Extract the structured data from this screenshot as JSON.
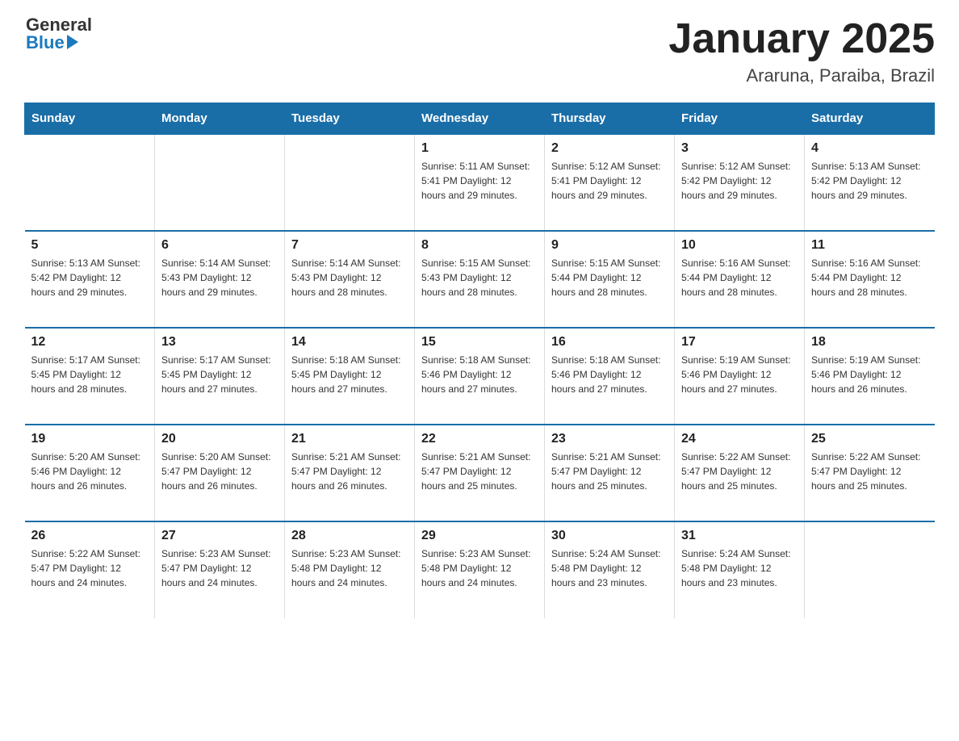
{
  "header": {
    "logo_general": "General",
    "logo_blue": "Blue",
    "title": "January 2025",
    "location": "Araruna, Paraiba, Brazil"
  },
  "calendar": {
    "days_of_week": [
      "Sunday",
      "Monday",
      "Tuesday",
      "Wednesday",
      "Thursday",
      "Friday",
      "Saturday"
    ],
    "weeks": [
      [
        {
          "day": "",
          "info": ""
        },
        {
          "day": "",
          "info": ""
        },
        {
          "day": "",
          "info": ""
        },
        {
          "day": "1",
          "info": "Sunrise: 5:11 AM\nSunset: 5:41 PM\nDaylight: 12 hours\nand 29 minutes."
        },
        {
          "day": "2",
          "info": "Sunrise: 5:12 AM\nSunset: 5:41 PM\nDaylight: 12 hours\nand 29 minutes."
        },
        {
          "day": "3",
          "info": "Sunrise: 5:12 AM\nSunset: 5:42 PM\nDaylight: 12 hours\nand 29 minutes."
        },
        {
          "day": "4",
          "info": "Sunrise: 5:13 AM\nSunset: 5:42 PM\nDaylight: 12 hours\nand 29 minutes."
        }
      ],
      [
        {
          "day": "5",
          "info": "Sunrise: 5:13 AM\nSunset: 5:42 PM\nDaylight: 12 hours\nand 29 minutes."
        },
        {
          "day": "6",
          "info": "Sunrise: 5:14 AM\nSunset: 5:43 PM\nDaylight: 12 hours\nand 29 minutes."
        },
        {
          "day": "7",
          "info": "Sunrise: 5:14 AM\nSunset: 5:43 PM\nDaylight: 12 hours\nand 28 minutes."
        },
        {
          "day": "8",
          "info": "Sunrise: 5:15 AM\nSunset: 5:43 PM\nDaylight: 12 hours\nand 28 minutes."
        },
        {
          "day": "9",
          "info": "Sunrise: 5:15 AM\nSunset: 5:44 PM\nDaylight: 12 hours\nand 28 minutes."
        },
        {
          "day": "10",
          "info": "Sunrise: 5:16 AM\nSunset: 5:44 PM\nDaylight: 12 hours\nand 28 minutes."
        },
        {
          "day": "11",
          "info": "Sunrise: 5:16 AM\nSunset: 5:44 PM\nDaylight: 12 hours\nand 28 minutes."
        }
      ],
      [
        {
          "day": "12",
          "info": "Sunrise: 5:17 AM\nSunset: 5:45 PM\nDaylight: 12 hours\nand 28 minutes."
        },
        {
          "day": "13",
          "info": "Sunrise: 5:17 AM\nSunset: 5:45 PM\nDaylight: 12 hours\nand 27 minutes."
        },
        {
          "day": "14",
          "info": "Sunrise: 5:18 AM\nSunset: 5:45 PM\nDaylight: 12 hours\nand 27 minutes."
        },
        {
          "day": "15",
          "info": "Sunrise: 5:18 AM\nSunset: 5:46 PM\nDaylight: 12 hours\nand 27 minutes."
        },
        {
          "day": "16",
          "info": "Sunrise: 5:18 AM\nSunset: 5:46 PM\nDaylight: 12 hours\nand 27 minutes."
        },
        {
          "day": "17",
          "info": "Sunrise: 5:19 AM\nSunset: 5:46 PM\nDaylight: 12 hours\nand 27 minutes."
        },
        {
          "day": "18",
          "info": "Sunrise: 5:19 AM\nSunset: 5:46 PM\nDaylight: 12 hours\nand 26 minutes."
        }
      ],
      [
        {
          "day": "19",
          "info": "Sunrise: 5:20 AM\nSunset: 5:46 PM\nDaylight: 12 hours\nand 26 minutes."
        },
        {
          "day": "20",
          "info": "Sunrise: 5:20 AM\nSunset: 5:47 PM\nDaylight: 12 hours\nand 26 minutes."
        },
        {
          "day": "21",
          "info": "Sunrise: 5:21 AM\nSunset: 5:47 PM\nDaylight: 12 hours\nand 26 minutes."
        },
        {
          "day": "22",
          "info": "Sunrise: 5:21 AM\nSunset: 5:47 PM\nDaylight: 12 hours\nand 25 minutes."
        },
        {
          "day": "23",
          "info": "Sunrise: 5:21 AM\nSunset: 5:47 PM\nDaylight: 12 hours\nand 25 minutes."
        },
        {
          "day": "24",
          "info": "Sunrise: 5:22 AM\nSunset: 5:47 PM\nDaylight: 12 hours\nand 25 minutes."
        },
        {
          "day": "25",
          "info": "Sunrise: 5:22 AM\nSunset: 5:47 PM\nDaylight: 12 hours\nand 25 minutes."
        }
      ],
      [
        {
          "day": "26",
          "info": "Sunrise: 5:22 AM\nSunset: 5:47 PM\nDaylight: 12 hours\nand 24 minutes."
        },
        {
          "day": "27",
          "info": "Sunrise: 5:23 AM\nSunset: 5:47 PM\nDaylight: 12 hours\nand 24 minutes."
        },
        {
          "day": "28",
          "info": "Sunrise: 5:23 AM\nSunset: 5:48 PM\nDaylight: 12 hours\nand 24 minutes."
        },
        {
          "day": "29",
          "info": "Sunrise: 5:23 AM\nSunset: 5:48 PM\nDaylight: 12 hours\nand 24 minutes."
        },
        {
          "day": "30",
          "info": "Sunrise: 5:24 AM\nSunset: 5:48 PM\nDaylight: 12 hours\nand 23 minutes."
        },
        {
          "day": "31",
          "info": "Sunrise: 5:24 AM\nSunset: 5:48 PM\nDaylight: 12 hours\nand 23 minutes."
        },
        {
          "day": "",
          "info": ""
        }
      ]
    ]
  }
}
